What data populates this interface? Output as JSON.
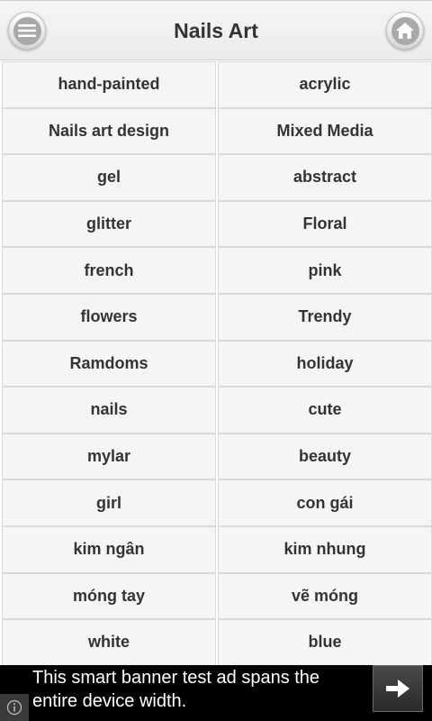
{
  "header": {
    "title": "Nails Art",
    "menu_icon": "menu-icon",
    "home_icon": "home-icon"
  },
  "categories": [
    "hand-painted",
    "acrylic",
    "Nails art design",
    "Mixed Media",
    "gel",
    "abstract",
    "glitter",
    "Floral",
    "french",
    "pink",
    "flowers",
    "Trendy",
    "Ramdoms",
    "holiday",
    "nails",
    "cute",
    "mylar",
    "beauty",
    "girl",
    "con gái",
    "kim ngân",
    "kim nhung",
    "móng tay",
    "vẽ móng",
    "white",
    "blue"
  ],
  "ad": {
    "text": "This smart banner test ad spans the entire device width.",
    "arrow_icon": "arrow-right-icon",
    "info_icon": "info-icon"
  },
  "colors": {
    "header_bg": "#efefef",
    "cell_bg": "#f5f5f5",
    "text": "#333333",
    "ad_bg": "#000000"
  }
}
